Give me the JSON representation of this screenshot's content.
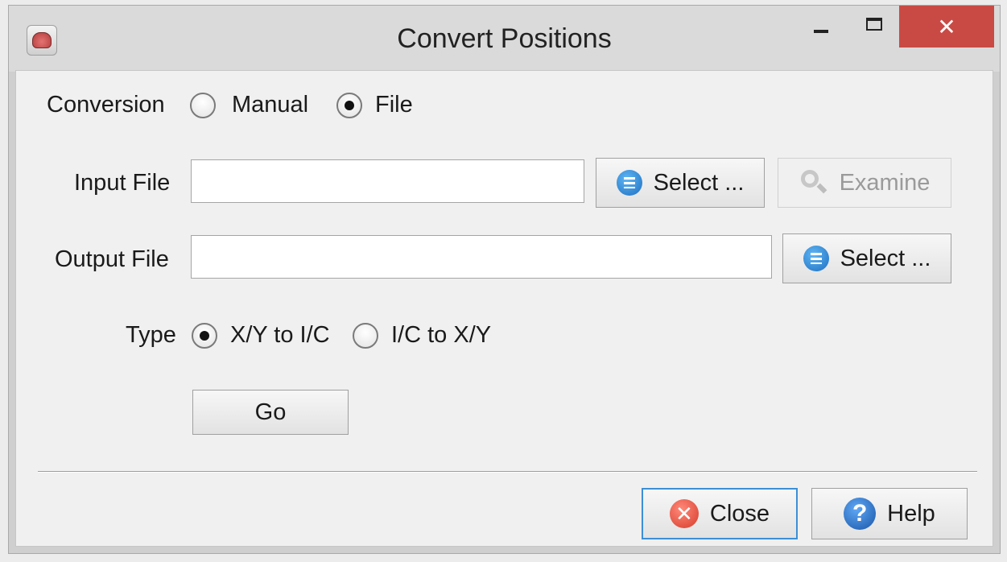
{
  "window": {
    "title": "Convert Positions",
    "close_glyph": "✕"
  },
  "conversion": {
    "label": "Conversion",
    "options": [
      "Manual",
      "File"
    ],
    "selected": "File"
  },
  "input_file": {
    "label": "Input File",
    "value": "",
    "select_label": "Select ...",
    "examine_label": "Examine"
  },
  "output_file": {
    "label": "Output File",
    "value": "",
    "select_label": "Select ..."
  },
  "type": {
    "label": "Type",
    "options": [
      "X/Y to I/C",
      "I/C to X/Y"
    ],
    "selected": "X/Y to I/C"
  },
  "go_label": "Go",
  "footer": {
    "close_label": "Close",
    "help_label": "Help",
    "close_glyph": "✕",
    "help_glyph": "?"
  },
  "icons": {
    "app": "app-icon",
    "list": "list-icon",
    "examine": "magnifier-icon",
    "close": "close-x-icon",
    "help": "question-icon"
  },
  "colors": {
    "title_close_bg": "#c94a45",
    "focus_border": "#3c8fd6"
  }
}
